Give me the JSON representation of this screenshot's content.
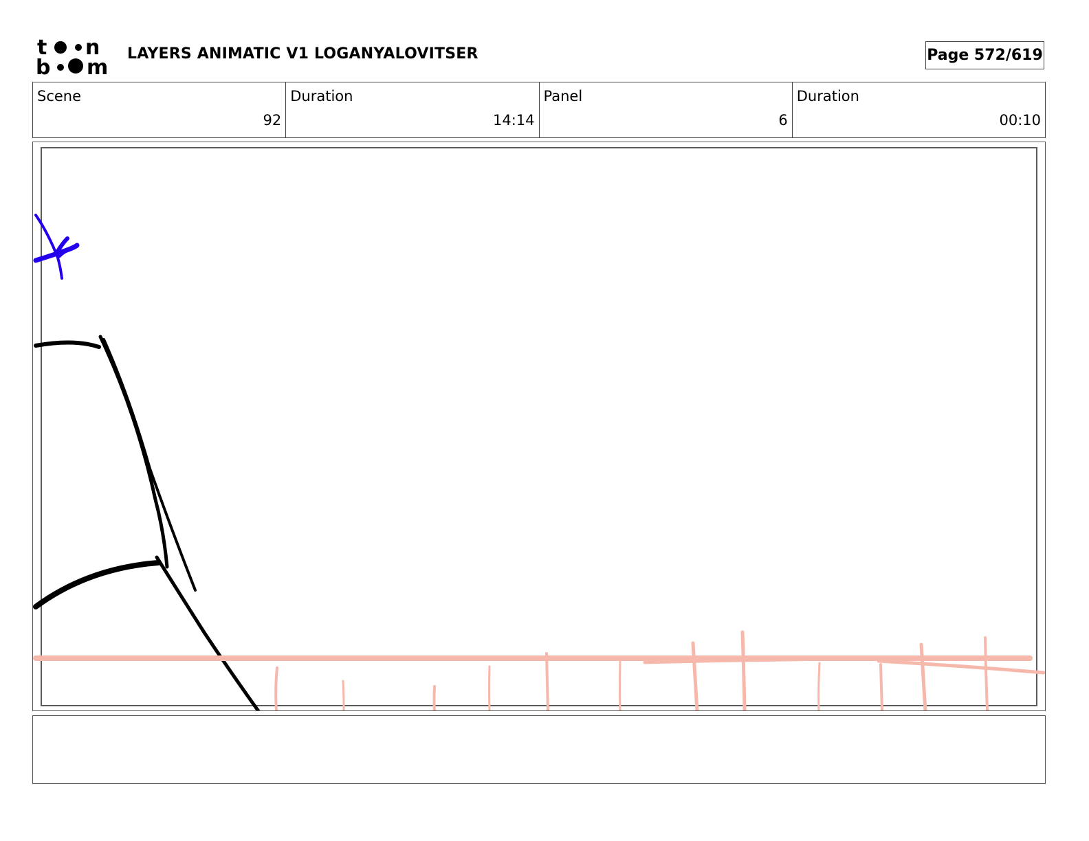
{
  "header": {
    "logo_text_top": "toon",
    "logo_text_bottom": "boom",
    "title": "LAYERS ANIMATIC V1 LOGANYALOVITSER",
    "page": "Page 572/619"
  },
  "info": {
    "scene_label": "Scene",
    "scene_value": "92",
    "scene_duration_label": "Duration",
    "scene_duration_value": "14:14",
    "panel_label": "Panel",
    "panel_value": "6",
    "panel_duration_label": "Duration",
    "panel_duration_value": "00:10"
  },
  "panel": {
    "sketch_colors": {
      "outline": "#000000",
      "character": "#2200ee",
      "ground": "#f7b8ac"
    }
  },
  "notes": {
    "text": ""
  }
}
